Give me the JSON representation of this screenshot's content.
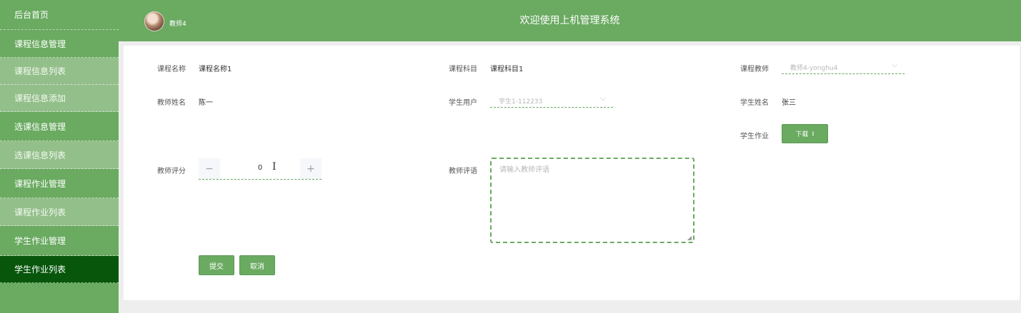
{
  "sidebar": {
    "items": [
      {
        "label": "后台首页"
      },
      {
        "label": "课程信息管理"
      },
      {
        "label": "课程信息列表"
      },
      {
        "label": "课程信息添加"
      },
      {
        "label": "选课信息管理"
      },
      {
        "label": "选课信息列表"
      },
      {
        "label": "课程作业管理"
      },
      {
        "label": "课程作业列表"
      },
      {
        "label": "学生作业管理"
      },
      {
        "label": "学生作业列表"
      }
    ],
    "active_label": "学生作业列表"
  },
  "header": {
    "username": "教师4",
    "title": "欢迎使用上机管理系统"
  },
  "form": {
    "course_name": {
      "label": "课程名称",
      "value": "课程名称1"
    },
    "course_subject": {
      "label": "课程科目",
      "value": "课程科目1"
    },
    "course_teacher": {
      "label": "课程教师",
      "value": "教师4-yonghu4"
    },
    "teacher_name": {
      "label": "教师姓名",
      "value": "陈一"
    },
    "student_user": {
      "label": "学生用户",
      "value": "学生1-112233"
    },
    "student_name": {
      "label": "学生姓名",
      "value": "张三"
    },
    "student_homework": {
      "label": "学生作业",
      "button": "下载"
    },
    "teacher_score": {
      "label": "教师评分",
      "value": "0",
      "minus": "−",
      "plus": "+"
    },
    "teacher_comment": {
      "label": "教师评语",
      "placeholder": "请输入教师评语"
    },
    "submit_label": "提交",
    "cancel_label": "取消"
  },
  "icons": {
    "chevron": "chevron-down-icon",
    "download": "download-icon"
  },
  "colors": {
    "brand_green": "#6aaa61",
    "sub_item_green": "#93bf8a",
    "active_green": "#07560b"
  }
}
